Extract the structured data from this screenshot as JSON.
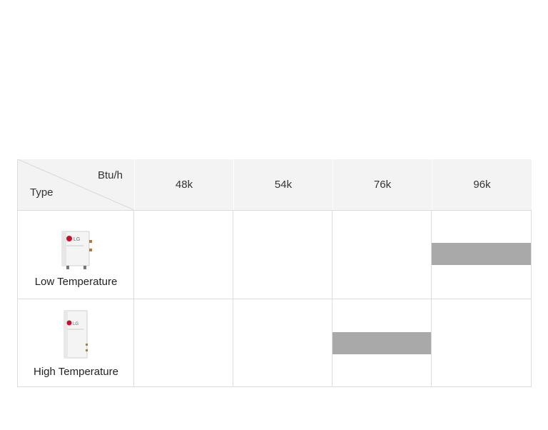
{
  "table": {
    "corner_unit": "Btu/h",
    "corner_type": "Type",
    "columns": [
      "48k",
      "54k",
      "76k",
      "96k"
    ],
    "rows": [
      {
        "label": "Low Temperature",
        "capacity": "96k",
        "logo": "LG",
        "image": "low-temperature-unit-image"
      },
      {
        "label": "High Temperature",
        "capacity": "76k",
        "logo": "LG",
        "image": "high-temperature-unit-image"
      }
    ]
  },
  "colors": {
    "header_bg": "#f3f3f3",
    "bar": "#a9a9a9",
    "grid": "#dcdcdc",
    "lg_red": "#c8102e"
  }
}
